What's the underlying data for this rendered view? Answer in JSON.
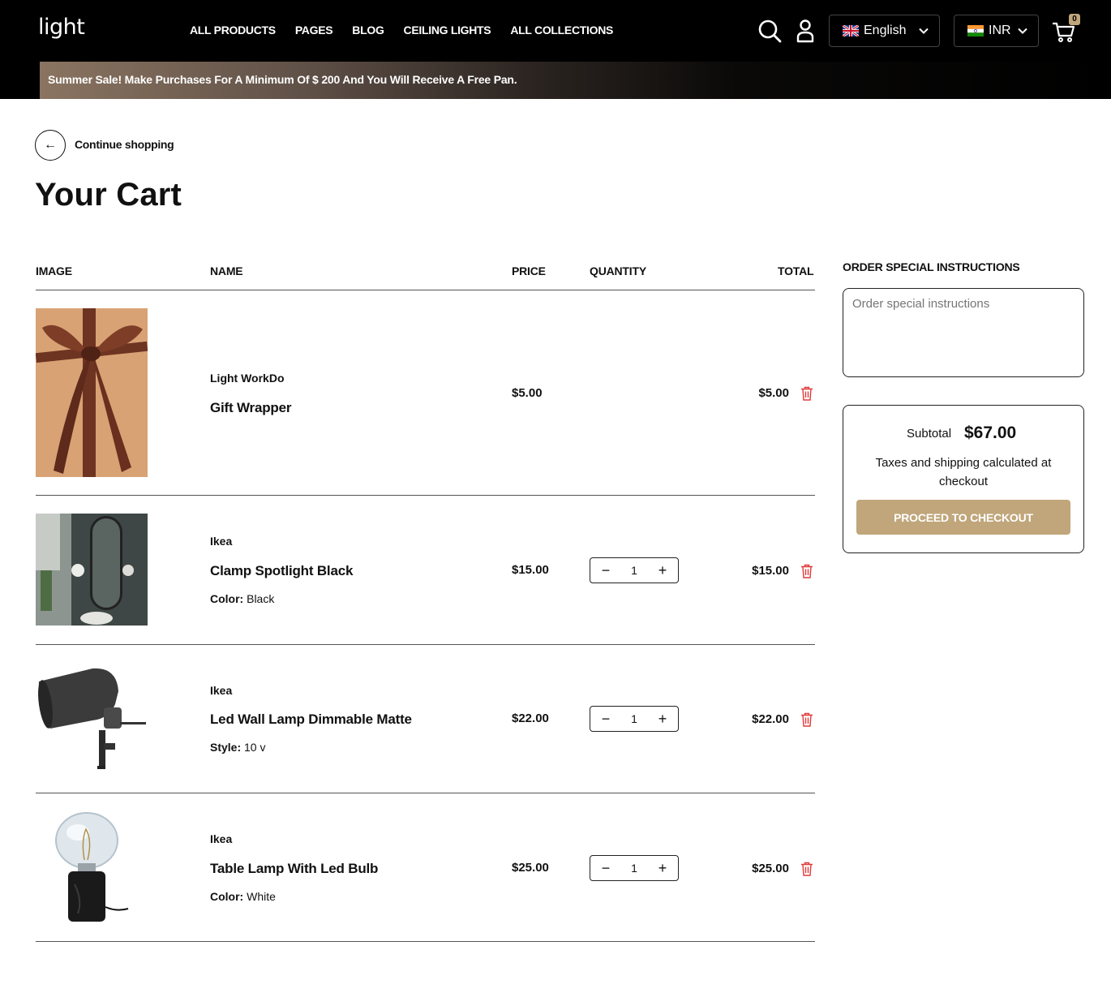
{
  "header": {
    "logo": "light",
    "nav": [
      "ALL PRODUCTS",
      "PAGES",
      "BLOG",
      "CEILING LIGHTS",
      "ALL COLLECTIONS"
    ],
    "language": "English",
    "currency": "INR",
    "cart_count": "0"
  },
  "promo": {
    "text": "Summer Sale! Make Purchases For A Minimum Of $ 200 And You Will Receive A Free Pan."
  },
  "back": {
    "label": "Continue shopping"
  },
  "page_title": "Your Cart",
  "table": {
    "headers": {
      "image": "IMAGE",
      "name": "NAME",
      "price": "PRICE",
      "quantity": "QUANTITY",
      "total": "TOTAL"
    },
    "rows": [
      {
        "vendor": "Light WorkDo",
        "name": "Gift Wrapper",
        "variant_label": "",
        "variant_value": "",
        "price": "$5.00",
        "quantity": "",
        "total": "$5.00"
      },
      {
        "vendor": "Ikea",
        "name": "Clamp Spotlight Black",
        "variant_label": "Color:",
        "variant_value": "Black",
        "price": "$15.00",
        "quantity": "1",
        "total": "$15.00"
      },
      {
        "vendor": "Ikea",
        "name": "Led Wall Lamp Dimmable Matte",
        "variant_label": "Style:",
        "variant_value": "10 v",
        "price": "$22.00",
        "quantity": "1",
        "total": "$22.00"
      },
      {
        "vendor": "Ikea",
        "name": "Table Lamp With Led Bulb",
        "variant_label": "Color:",
        "variant_value": "White",
        "price": "$25.00",
        "quantity": "1",
        "total": "$25.00"
      }
    ]
  },
  "sidebar": {
    "instructions_title": "ORDER SPECIAL INSTRUCTIONS",
    "instructions_placeholder": "Order special instructions",
    "subtotal_label": "Subtotal",
    "subtotal_value": "$67.00",
    "tax_note": "Taxes and shipping calculated at checkout",
    "checkout_label": "PROCEED TO CHECKOUT"
  },
  "colors": {
    "accent": "#c0a67a",
    "header_bg": "#000000",
    "trash": "#e03a3a"
  }
}
